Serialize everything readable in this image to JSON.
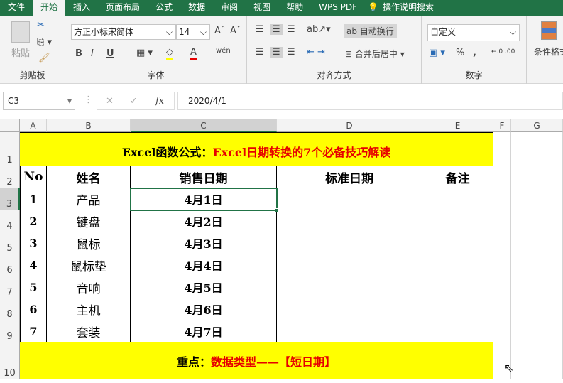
{
  "tabs": [
    "文件",
    "开始",
    "插入",
    "页面布局",
    "公式",
    "数据",
    "审阅",
    "视图",
    "帮助",
    "WPS PDF",
    "操作说明搜索"
  ],
  "ribbon": {
    "clipboard": {
      "paste": "粘贴",
      "label": "剪贴板"
    },
    "font": {
      "name": "方正小标宋简体",
      "size": "14",
      "bold": "B",
      "italic": "I",
      "underline": "U",
      "phonetic": "wén",
      "label": "字体"
    },
    "align": {
      "wrap": "自动换行",
      "merge": "合并后居中",
      "label": "对齐方式"
    },
    "number": {
      "format": "自定义",
      "percent": "%",
      "comma": ",",
      "label": "数字"
    },
    "styles": {
      "cond": "条件格式"
    }
  },
  "formula": {
    "namebox": "C3",
    "fx": "fx",
    "value": "2020/4/1"
  },
  "columns": [
    "A",
    "B",
    "C",
    "D",
    "E",
    "F",
    "G"
  ],
  "rows": [
    "1",
    "2",
    "3",
    "4",
    "5",
    "6",
    "7",
    "8",
    "9",
    "10"
  ],
  "title": {
    "black": "Excel函数公式：",
    "red": "Excel日期转换的7个必备技巧解读"
  },
  "headers": [
    "No",
    "姓名",
    "销售日期",
    "标准日期",
    "备注"
  ],
  "data": [
    [
      "1",
      "产品",
      "4月1日"
    ],
    [
      "2",
      "键盘",
      "4月2日"
    ],
    [
      "3",
      "鼠标",
      "4月3日"
    ],
    [
      "4",
      "鼠标垫",
      "4月4日"
    ],
    [
      "5",
      "音响",
      "4月5日"
    ],
    [
      "6",
      "主机",
      "4月6日"
    ],
    [
      "7",
      "套装",
      "4月7日"
    ]
  ],
  "footer": {
    "black": "重点：",
    "red": "数据类型——【短日期】"
  }
}
